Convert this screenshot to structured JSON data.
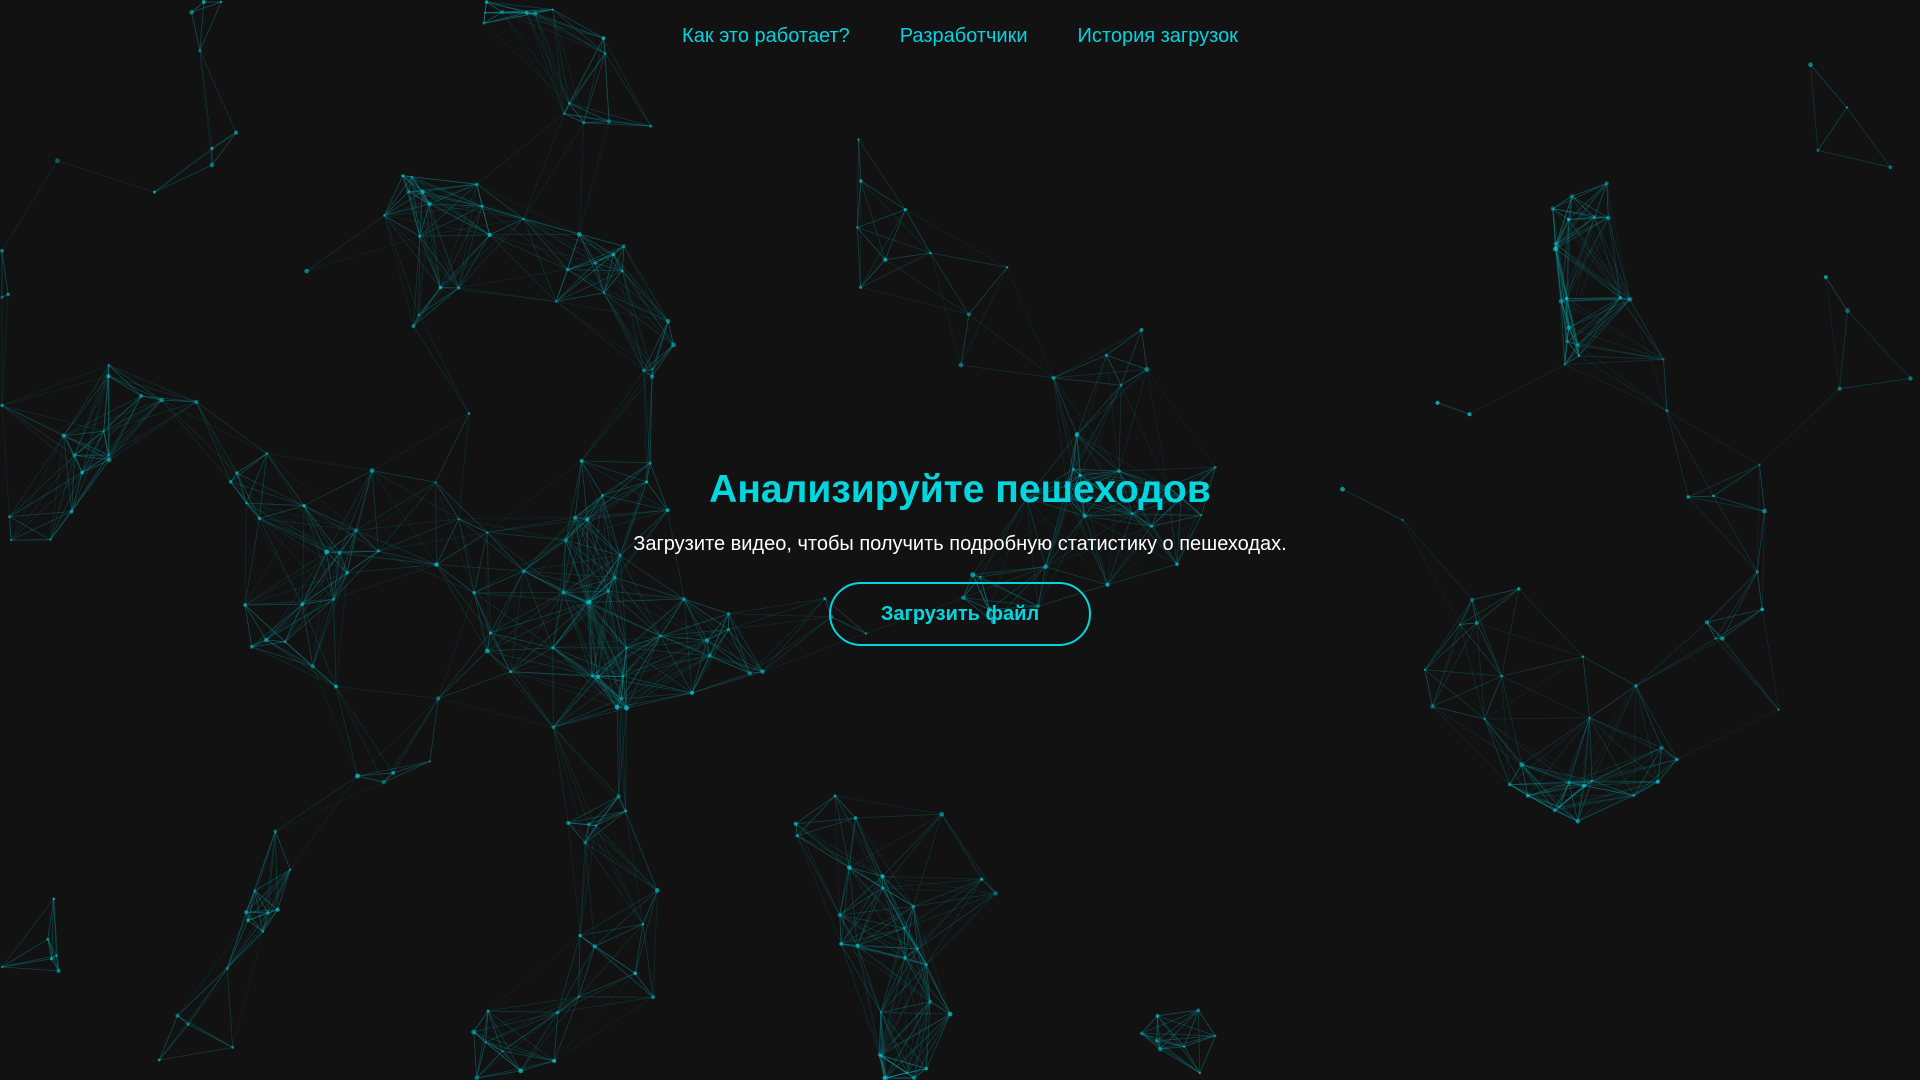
{
  "nav": {
    "items": [
      {
        "label": "Как это работает?"
      },
      {
        "label": "Разработчики"
      },
      {
        "label": "История загрузок"
      }
    ]
  },
  "hero": {
    "title": "Анализируйте пешеходов",
    "subtitle": "Загрузите видео, чтобы получить подробную статистику о пешеходах.",
    "upload_label": "Загрузить файл"
  },
  "colors": {
    "background": "#121212",
    "accent": "#00d6e0",
    "network_line": "#0b8f96",
    "subtitle_text": "#ffffff"
  }
}
